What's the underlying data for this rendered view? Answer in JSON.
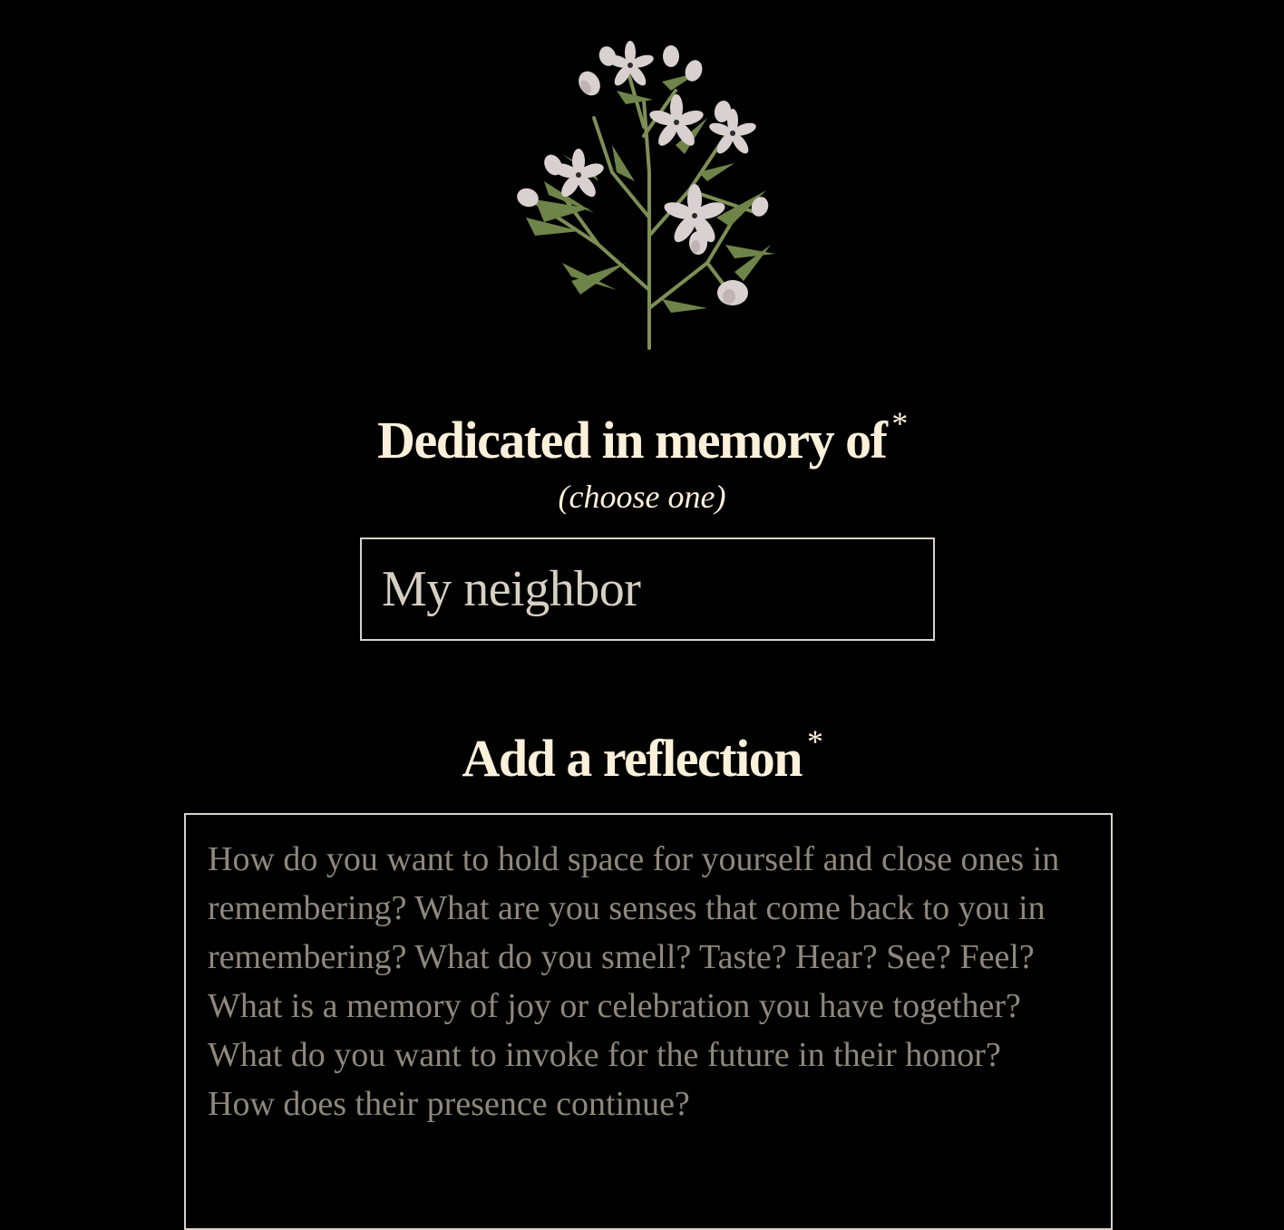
{
  "illustration": {
    "icon": "wildflower-sprig-illustration",
    "colors": {
      "stem": "#7d8f55",
      "leaf": "#6f8448",
      "petal": "#d9d0d0",
      "petal_shade": "#bfb3b6",
      "center": "#2b2b2b"
    }
  },
  "dedication": {
    "label": "Dedicated in memory of",
    "required_mark": "*",
    "hint": "(choose one)",
    "selected_value": "My neighbor"
  },
  "reflection": {
    "label": "Add a reflection",
    "required_mark": "*",
    "placeholder": "How do you want to hold space for yourself and close ones in\nremembering? What are you senses that come back to you in\nremembering? What do you smell? Taste? Hear? See? Feel?\nWhat is a memory of joy or celebration you have together?\nWhat do you want to invoke for the future in their honor?\nHow does their presence continue?"
  },
  "colors": {
    "background": "#000000",
    "heading_text": "#fbf0da",
    "field_border": "#d6d2c8",
    "field_value": "#d7d0c2",
    "placeholder_text": "#8e887c"
  }
}
